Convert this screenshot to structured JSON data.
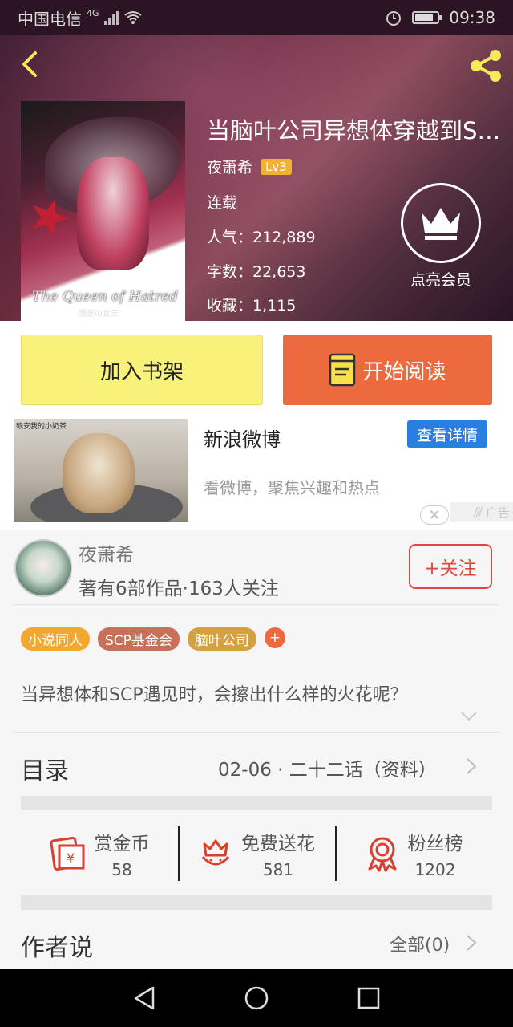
{
  "status_bar": {
    "carrier": "中国电信",
    "network": "4G",
    "time": "09:38"
  },
  "book": {
    "title": "当脑叶公司异想体穿越到S…",
    "author": "夜萧希",
    "level": "Lv3",
    "status": "连载",
    "popularity_label": "人气：212,889",
    "wordcount_label": "字数：22,653",
    "favorites_label": "收藏：1,115",
    "cover_text": "The Queen of Hatred",
    "cover_subtext": "憎恶の女王"
  },
  "vip": {
    "label": "点亮会员",
    "icon": "crown-icon"
  },
  "actions": {
    "add_shelf": "加入书架",
    "start_read": "开始阅读",
    "read_icon": "book-icon"
  },
  "ad": {
    "image_caption": "赖安我的小奶茶",
    "title": "新浪微博",
    "button": "查看详情",
    "desc": "看微博，聚焦兴趣和热点",
    "tag": "广告",
    "close": "✕"
  },
  "author_info": {
    "name": "夜萧希",
    "stats": "著有6部作品·163人关注",
    "follow": "+关注"
  },
  "tags": [
    {
      "label": "小说同人",
      "color": "#f2a830"
    },
    {
      "label": "SCP基金会",
      "color": "#c8705a"
    },
    {
      "label": "脑叶公司",
      "color": "#d4a040"
    }
  ],
  "tag_add": "+",
  "description": "当异想体和SCP遇见时，会擦出什么样的火花呢？",
  "toc": {
    "label": "目录",
    "latest": "02-06 · 二十二话（资料）"
  },
  "rewards": [
    {
      "label": "赏金币",
      "value": "58",
      "icon": "red-envelope-icon"
    },
    {
      "label": "免费送花",
      "value": "581",
      "icon": "flower-icon"
    },
    {
      "label": "粉丝榜",
      "value": "1202",
      "icon": "medal-icon"
    }
  ],
  "author_says": {
    "label": "作者说",
    "all": "全部(0)"
  },
  "colors": {
    "accent_orange": "#ec6a3e",
    "shelf_yellow": "#f8f27a",
    "follow_red": "#e04a3a",
    "ad_blue": "#2a7ee2",
    "icon_red": "#d84030"
  }
}
